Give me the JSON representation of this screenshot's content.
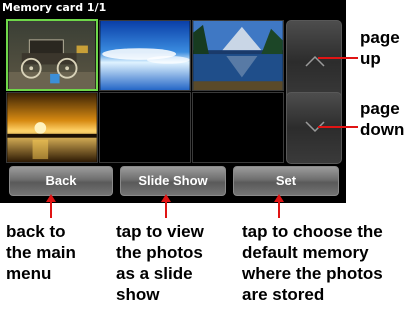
{
  "screen": {
    "title": "Memory card 1/1",
    "thumbnails": [
      {
        "id": "t1",
        "subject": "vintage automobile",
        "selected": true
      },
      {
        "id": "t2",
        "subject": "blue sky with clouds over water",
        "selected": false
      },
      {
        "id": "t3",
        "subject": "mountain lake with trees",
        "selected": false
      },
      {
        "id": "t4",
        "subject": "golden sunset over water",
        "selected": false
      }
    ],
    "page_up_icon": "chevron-up-icon",
    "page_down_icon": "chevron-down-icon",
    "buttons": {
      "back": "Back",
      "slideshow": "Slide Show",
      "set": "Set"
    }
  },
  "annotations": {
    "page_up": [
      "page",
      "up"
    ],
    "page_down": [
      "page",
      "down"
    ],
    "back": [
      "back to",
      "the main",
      "menu"
    ],
    "slideshow": [
      "tap to view",
      "the photos",
      "as a slide",
      "show"
    ],
    "set": [
      "tap to choose the",
      "default memory",
      "where the photos",
      "are stored"
    ]
  },
  "colors": {
    "annotation_line": "#e01414",
    "selection_border": "#6fd84a"
  }
}
